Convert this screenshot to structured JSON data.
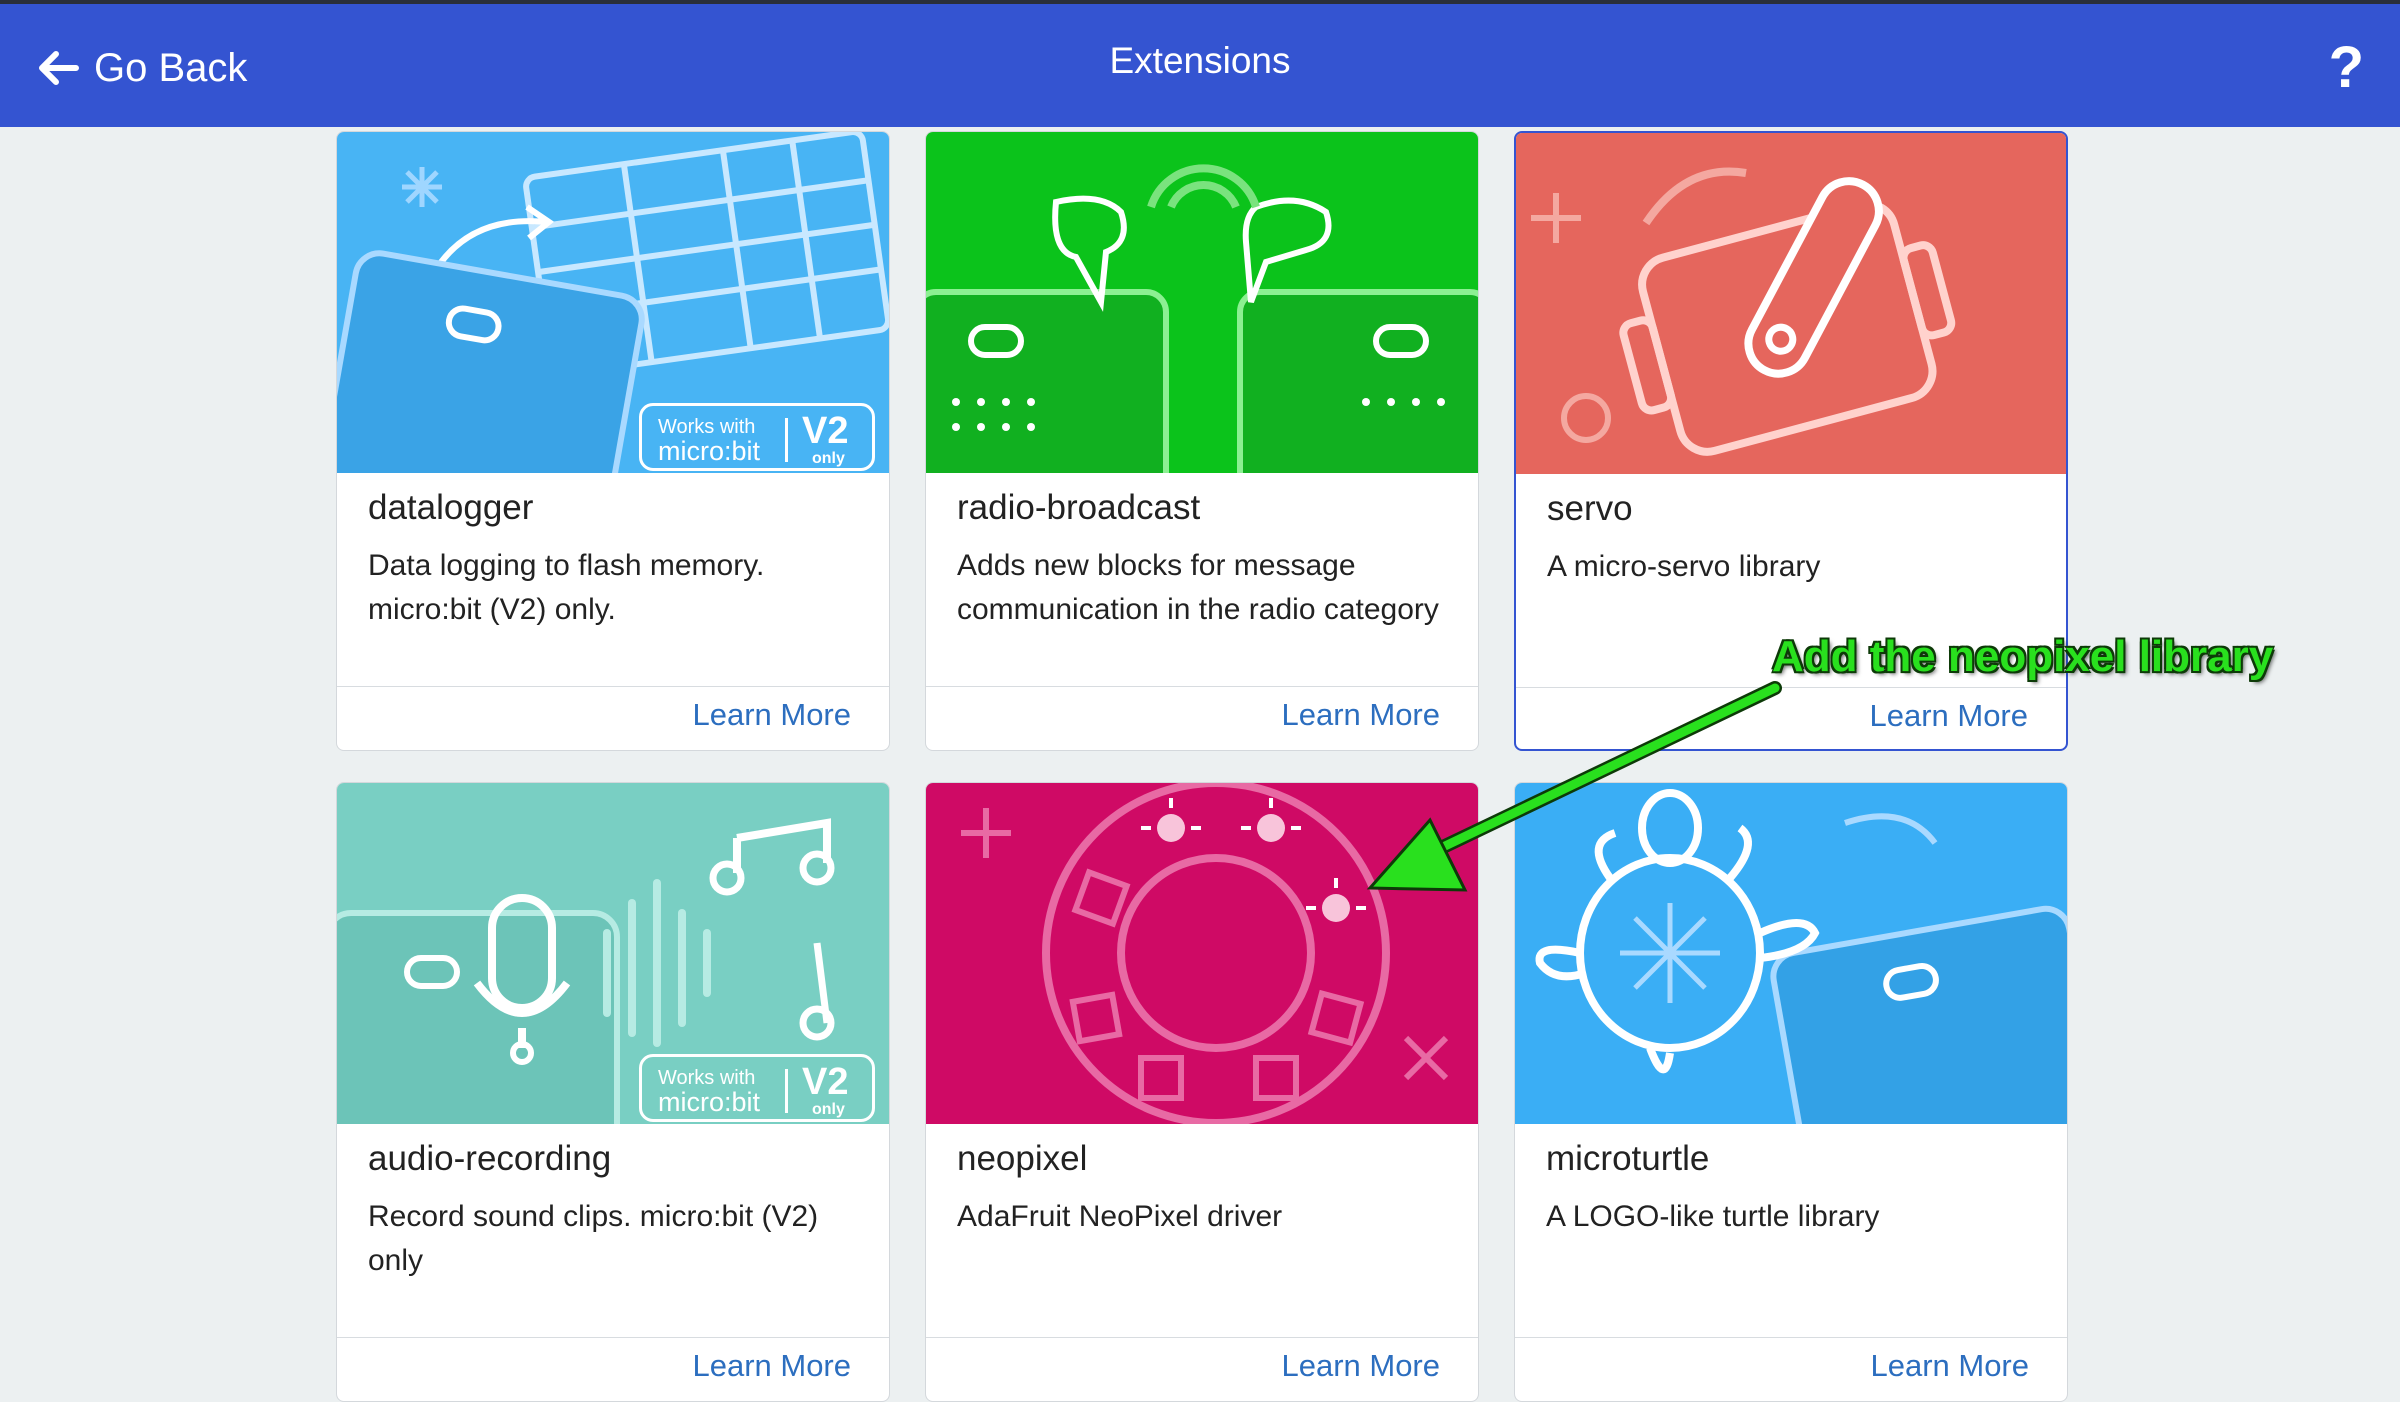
{
  "header": {
    "back_label": "Go Back",
    "title": "Extensions",
    "help_label": "?"
  },
  "badge": {
    "works_with": "Works with",
    "brand": "micro:bit",
    "version": "V2",
    "only": "only"
  },
  "cards": [
    {
      "name": "datalogger",
      "desc": "Data logging to flash memory. micro:bit (V2) only.",
      "learn": "Learn More",
      "color": "#48b4f4"
    },
    {
      "name": "radio-broadcast",
      "desc": "Adds new blocks for message communication in the radio category",
      "learn": "Learn More",
      "color": "#0bc31b"
    },
    {
      "name": "servo",
      "desc": "A micro-servo library",
      "learn": "Learn More",
      "color": "#e5665d"
    },
    {
      "name": "audio-recording",
      "desc": "Record sound clips. micro:bit (V2) only",
      "learn": "Learn More",
      "color": "#79cfc3"
    },
    {
      "name": "neopixel",
      "desc": "AdaFruit NeoPixel driver",
      "learn": "Learn More",
      "color": "#cf0a65"
    },
    {
      "name": "microturtle",
      "desc": "A LOGO-like turtle library",
      "learn": "Learn More",
      "color": "#3aaef5"
    }
  ],
  "annotation": {
    "text": "Add the neopixel library",
    "color": "#29e01e"
  }
}
